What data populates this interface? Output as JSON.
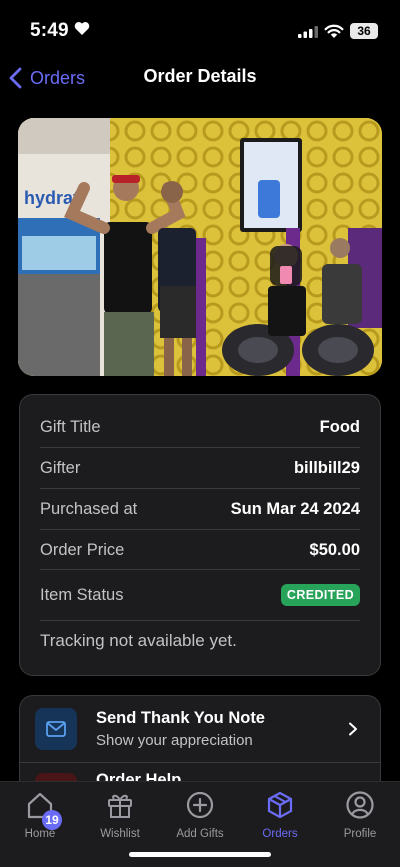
{
  "status_bar": {
    "time": "5:49",
    "battery": "36"
  },
  "nav": {
    "back_label": "Orders",
    "title": "Order Details"
  },
  "photo": {
    "wall_text": "hydrat"
  },
  "details": {
    "rows": [
      {
        "key": "Gift Title",
        "value": "Food"
      },
      {
        "key": "Gifter",
        "value": "billbill29"
      },
      {
        "key": "Purchased at",
        "value": "Sun Mar 24 2024"
      },
      {
        "key": "Order Price",
        "value": "$50.00"
      }
    ],
    "status_key": "Item Status",
    "status_value": "CREDITED",
    "status_color": "#27a35a",
    "tracking_text": "Tracking not available yet."
  },
  "actions": [
    {
      "title": "Send Thank You Note",
      "subtitle": "Show your appreciation",
      "icon": "envelope-icon"
    },
    {
      "title": "Order Help",
      "subtitle": "",
      "icon": "help-icon"
    }
  ],
  "tabbar": {
    "tabs": [
      {
        "label": "Home",
        "icon": "home-icon",
        "badge": "19"
      },
      {
        "label": "Wishlist",
        "icon": "gift-icon"
      },
      {
        "label": "Add Gifts",
        "icon": "plus-circle-icon"
      },
      {
        "label": "Orders",
        "icon": "box-icon",
        "active": true
      },
      {
        "label": "Profile",
        "icon": "profile-icon"
      }
    ]
  },
  "colors": {
    "accent": "#6b6cf6",
    "background": "#000000",
    "card": "#1c1c1e"
  }
}
